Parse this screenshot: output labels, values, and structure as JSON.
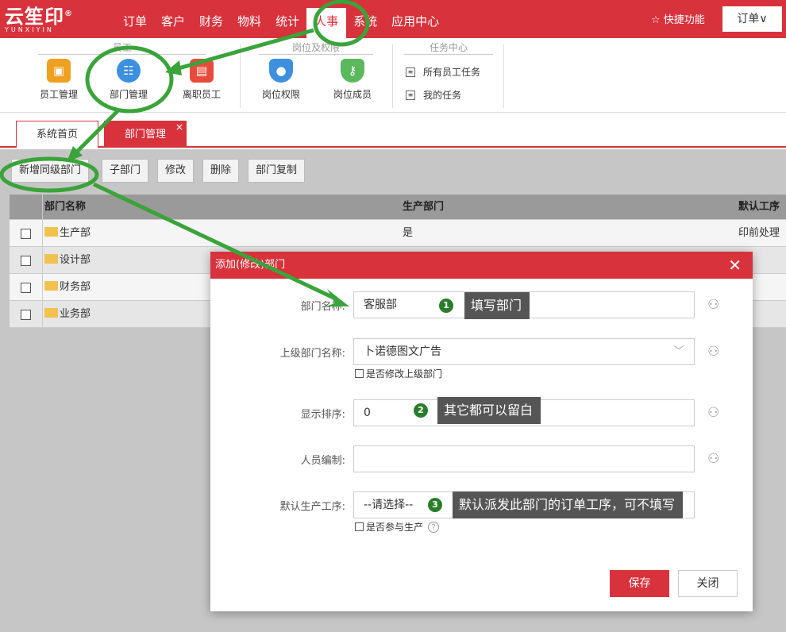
{
  "logo": {
    "main": "云笙印",
    "reg": "®",
    "sub": "YUNXIYIN"
  },
  "nav": {
    "items": [
      "订单",
      "客户",
      "财务",
      "物料",
      "统计",
      "人事",
      "系统",
      "应用中心"
    ],
    "active_index": 5
  },
  "quick": {
    "icon": "star-outline-icon",
    "label": "快捷功能"
  },
  "order_menu": "订单∨",
  "ribbon": {
    "groups": [
      "员工",
      "岗位及权限",
      "任务中心"
    ],
    "items": [
      {
        "label": "员工管理",
        "icon": "employee-card-icon",
        "color": "#f0a020"
      },
      {
        "label": "部门管理",
        "icon": "org-chart-icon",
        "color": "#3d8fe0"
      },
      {
        "label": "离职员工",
        "icon": "resign-card-icon",
        "color": "#e84b3c"
      },
      {
        "label": "岗位权限",
        "icon": "user-shield-icon",
        "color": "#3d8fe0"
      },
      {
        "label": "岗位成员",
        "icon": "key-shield-icon",
        "color": "#5cb85c"
      }
    ],
    "tasks": [
      "所有员工任务",
      "我的任务"
    ]
  },
  "tabs": {
    "home": "系统首页",
    "current": "部门管理",
    "close": "×"
  },
  "toolbar": [
    "新增同级部门",
    "子部门",
    "修改",
    "删除",
    "部门复制"
  ],
  "table": {
    "headers": {
      "name": "部门名称",
      "prod": "生产部门",
      "def": "默认工序"
    },
    "rows": [
      {
        "name": "生产部",
        "prod": "是",
        "def": "印前处理"
      },
      {
        "name": "设计部",
        "prod": "",
        "def": ""
      },
      {
        "name": "财务部",
        "prod": "",
        "def": ""
      },
      {
        "name": "业务部",
        "prod": "",
        "def": ""
      }
    ]
  },
  "modal": {
    "title": "添加(修改)部门",
    "close": "✕",
    "fields": {
      "name": {
        "label": "部门名称:",
        "value": "客服部"
      },
      "parent": {
        "label": "上级部门名称:",
        "value": "卜诺德图文广告",
        "checkbox": "是否修改上级部门"
      },
      "order": {
        "label": "显示排序:",
        "value": "0"
      },
      "staff": {
        "label": "人员编制:",
        "value": ""
      },
      "proc": {
        "label": "默认生产工序:",
        "value": "--请选择--",
        "checkbox": "是否参与生产"
      }
    },
    "save": "保存",
    "cancel": "关闭"
  },
  "callouts": [
    {
      "num": "1",
      "text": "填写部门"
    },
    {
      "num": "2",
      "text": "其它都可以留白"
    },
    {
      "num": "3",
      "text": "默认派发此部门的订单工序，可不填写"
    }
  ],
  "colors": {
    "brand": "#d8323c",
    "annotation": "#3aa33a",
    "callout_bg": "#555555"
  }
}
